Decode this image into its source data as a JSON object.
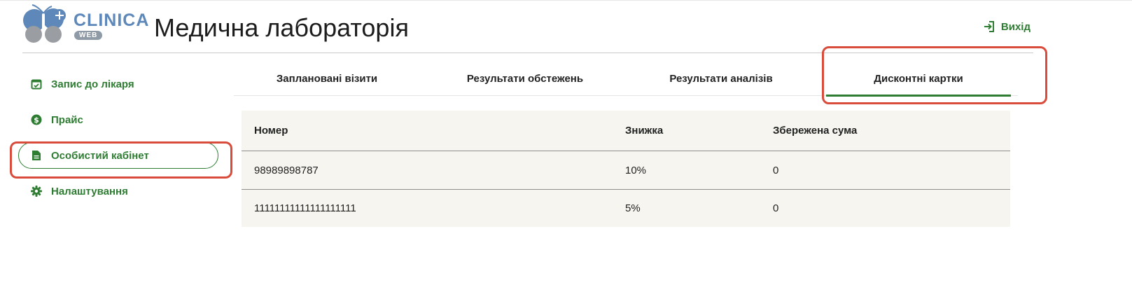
{
  "brand": {
    "name": "CLINICA",
    "sub": "WEB",
    "colors": {
      "primary": "#2e7d32",
      "logo_blue": "#5e88ba",
      "highlight": "#d94b3b"
    }
  },
  "header": {
    "title": "Медична лабораторія",
    "logout_label": "Вихід"
  },
  "sidebar": {
    "items": [
      {
        "label": "Запис до лікаря",
        "icon": "calendar-check-icon"
      },
      {
        "label": "Прайс",
        "icon": "dollar-circle-icon"
      },
      {
        "label": "Особистий кабінет",
        "icon": "document-icon",
        "active": true
      },
      {
        "label": "Налаштування",
        "icon": "gear-icon"
      }
    ]
  },
  "tabs": [
    {
      "label": "Заплановані візити"
    },
    {
      "label": "Результати обстежень"
    },
    {
      "label": "Результати аналізів"
    },
    {
      "label": "Дисконтні картки",
      "active": true
    }
  ],
  "table": {
    "columns": [
      "Номер",
      "Знижка",
      "Збережена сума"
    ],
    "rows": [
      [
        "98989898787",
        "10%",
        "0"
      ],
      [
        "11111111111111111111",
        "5%",
        "0"
      ]
    ]
  }
}
